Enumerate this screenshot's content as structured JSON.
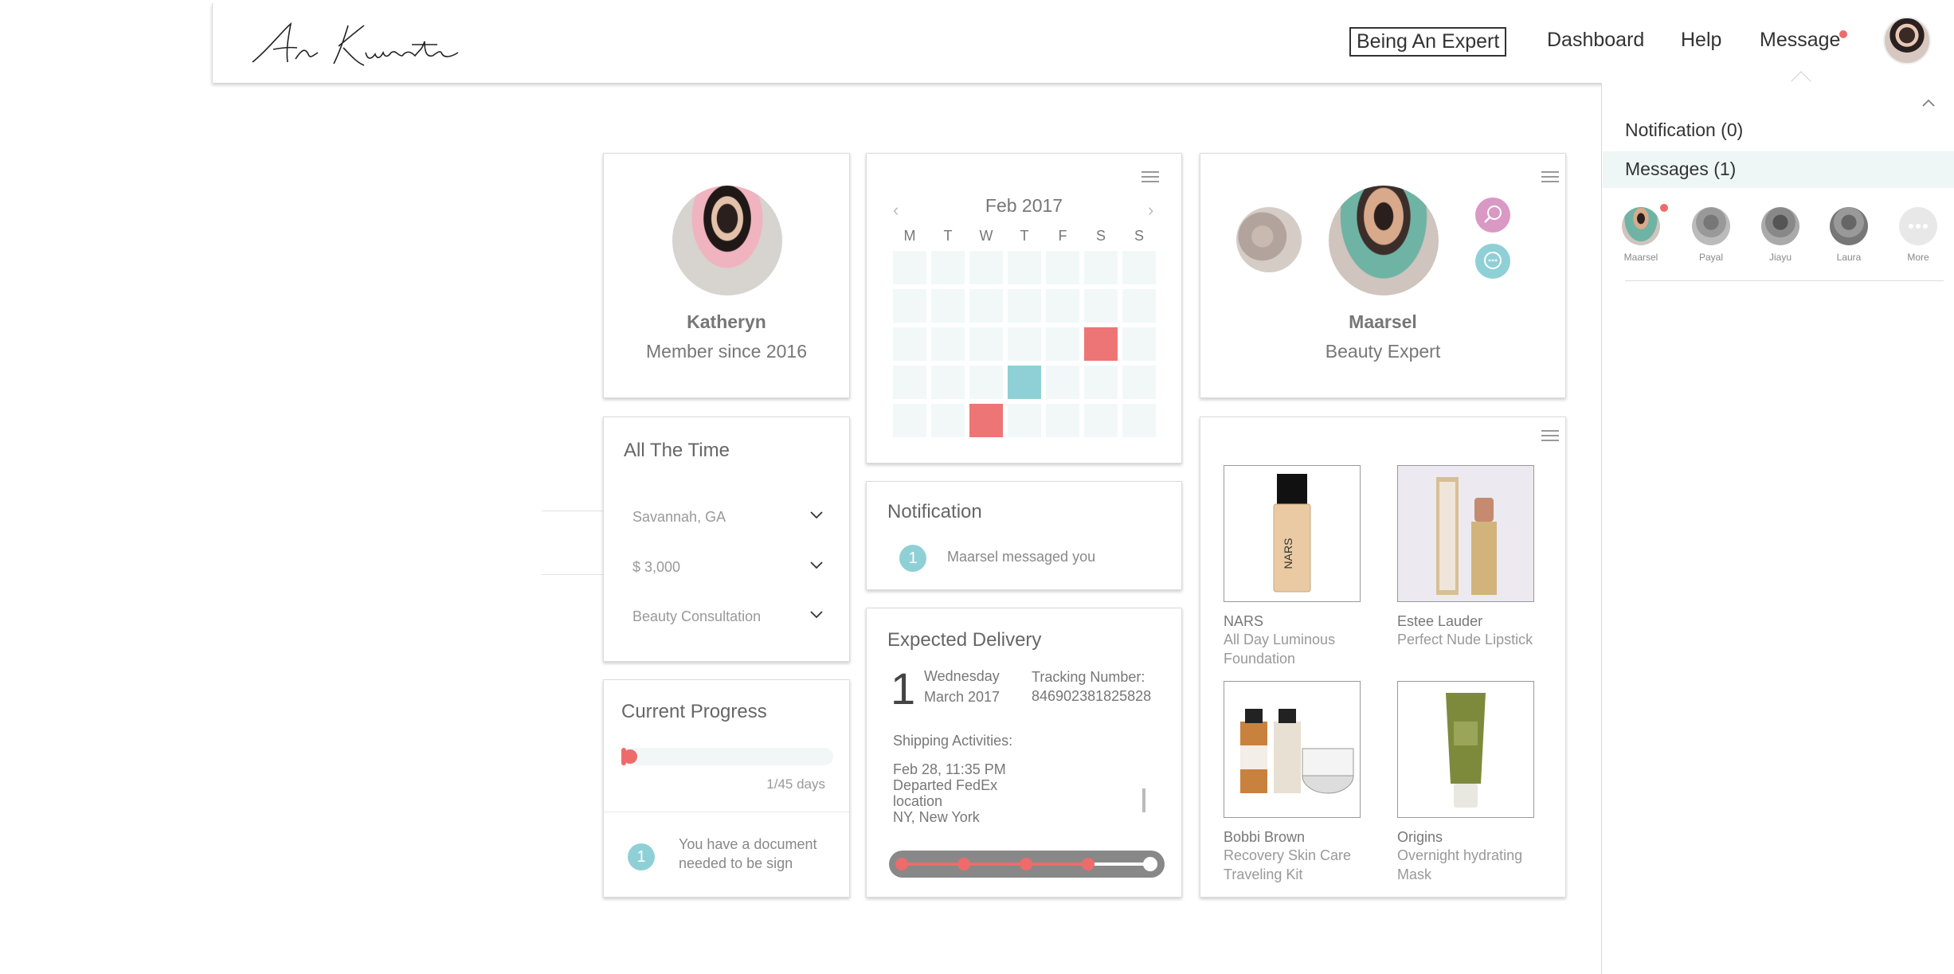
{
  "header": {
    "logo_text": "An Kurate",
    "nav": {
      "expert": "Being An Expert",
      "dashboard": "Dashboard",
      "help": "Help",
      "message": "Message"
    }
  },
  "right_panel": {
    "notification_tab": "Notification (0)",
    "messages_tab": "Messages (1)",
    "contacts": [
      {
        "name": "Maarsel"
      },
      {
        "name": "Payal"
      },
      {
        "name": "Jiayu"
      },
      {
        "name": "Laura"
      },
      {
        "name": "More"
      }
    ]
  },
  "profile": {
    "name": "Katheryn",
    "member": "Member since 2016"
  },
  "filters": {
    "title": "All The Time",
    "location": "Savannah, GA",
    "budget": "$ 3,000",
    "service": "Beauty Consultation"
  },
  "progress": {
    "title": "Current Progress",
    "current_day": 1,
    "total_days": 45,
    "days_label": "1/45 days",
    "doc_count": "1",
    "doc_text": "You have a document needed to be sign"
  },
  "calendar": {
    "title": "Feb 2017",
    "weekdays": [
      "M",
      "T",
      "W",
      "T",
      "F",
      "S",
      "S"
    ],
    "rows": 5,
    "highlighted": [
      {
        "row": 2,
        "col": 5,
        "color": "red"
      },
      {
        "row": 3,
        "col": 3,
        "color": "teal"
      },
      {
        "row": 4,
        "col": 2,
        "color": "red"
      }
    ]
  },
  "notification": {
    "title": "Notification",
    "count": "1",
    "text": "Maarsel messaged you"
  },
  "delivery": {
    "title": "Expected Delivery",
    "day": "1",
    "weekday": "Wednesday",
    "month": "March 2017",
    "tracking_label": "Tracking Number:",
    "tracking_number": "846902381825828",
    "shipping_label": "Shipping Activities:",
    "activity_time": "Feb 28, 11:35 PM",
    "activity_desc": "Departed FedEx location",
    "activity_place": "NY, New York",
    "steps_completed": 4,
    "steps_total": 5
  },
  "expert": {
    "name": "Maarsel",
    "role": "Beauty Expert"
  },
  "products": [
    {
      "brand": "NARS",
      "name": "All Day Luminous Foundation"
    },
    {
      "brand": "Estee Lauder",
      "name": "Perfect Nude Lipstick"
    },
    {
      "brand": "Bobbi Brown",
      "name": "Recovery Skin Care Traveling Kit"
    },
    {
      "brand": "Origins",
      "name": "Overnight hydrating Mask"
    }
  ],
  "colors": {
    "accent_red": "#ee6b6b",
    "accent_teal": "#8fd0d6",
    "accent_pink": "#d999c4"
  }
}
